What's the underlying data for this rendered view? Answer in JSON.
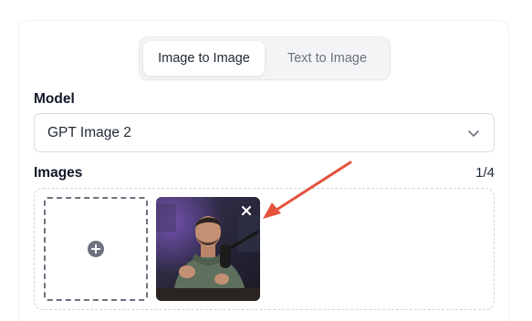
{
  "tabs": [
    {
      "label": "Image to Image",
      "active": true
    },
    {
      "label": "Text to Image",
      "active": false
    }
  ],
  "model": {
    "label": "Model",
    "selected": "GPT Image 2"
  },
  "images": {
    "label": "Images",
    "counter": "1/4"
  },
  "icons": {
    "add": "plus-circle-icon",
    "remove": "close-icon",
    "dropdown": "chevron-down-icon",
    "annotation": "red-arrow-icon"
  },
  "colors": {
    "accent_arrow": "#e5533d",
    "text": "#111827",
    "muted": "#6b7280"
  }
}
